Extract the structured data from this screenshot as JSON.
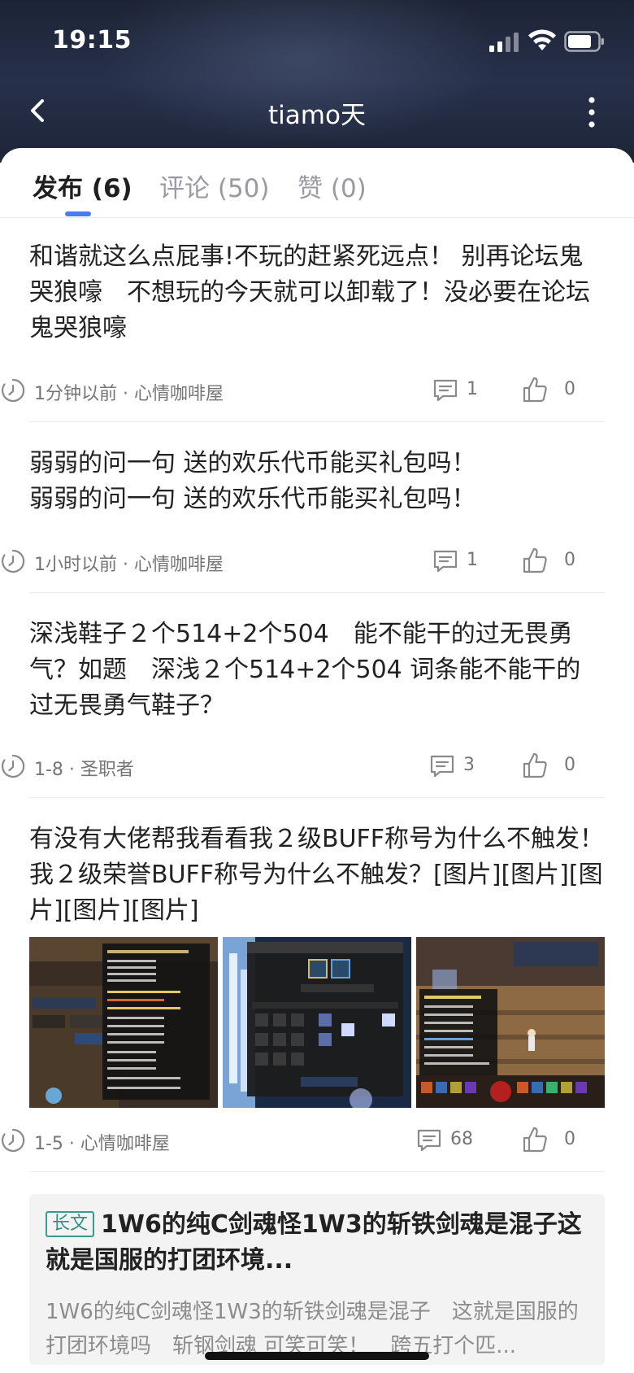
{
  "status_bar": {
    "time": "19:15"
  },
  "header": {
    "title": "tiamo天"
  },
  "tabs": [
    {
      "label": "发布 (6)",
      "active": true
    },
    {
      "label": "评论 (50)",
      "active": false
    },
    {
      "label": "赞 (0)",
      "active": false
    }
  ],
  "posts": [
    {
      "text": "和谐就这么点屁事!不玩的赶紧死远点！ 别再论坛鬼哭狼嚎　不想玩的今天就可以卸载了！没必要在论坛鬼哭狼嚎",
      "meta": "1分钟以前 · 心情咖啡屋",
      "comments": "1",
      "likes": "0"
    },
    {
      "text_line1": "弱弱的问一句 送的欢乐代币能买礼包吗！",
      "text_line2": "弱弱的问一句 送的欢乐代币能买礼包吗！",
      "meta": "1小时以前 · 心情咖啡屋",
      "comments": "1",
      "likes": "0"
    },
    {
      "text": "深浅鞋子２个514+2个504　能不能干的过无畏勇气？如题　深浅２个514+2个504 词条能不能干的过无畏勇气鞋子？",
      "meta": "1-8 · 圣职者",
      "comments": "3",
      "likes": "0"
    },
    {
      "text": "有没有大佬帮我看看我２级BUFF称号为什么不触发！ 我２级荣誉BUFF称号为什么不触发？[图片][图片][图片][图片][图片]",
      "images": [
        "game-screenshot-stats",
        "game-screenshot-equipment",
        "game-screenshot-character"
      ],
      "meta": "1-5 · 心情咖啡屋",
      "comments": "68",
      "likes": "0"
    }
  ],
  "long_post": {
    "tag": "长文",
    "title": "1W6的纯C剑魂怪1W3的斩铁剑魂是混子这就是国服的打团环境...",
    "excerpt": "1W6的纯C剑魂怪1W3的斩铁剑魂是混子　这就是国服的打团环境吗　斩钢剑魂 可笑可笑！　跨五打个匹..."
  },
  "icons": {
    "back": "chevron-left-icon",
    "more": "more-vertical-icon",
    "time": "clock-icon",
    "comment": "comment-icon",
    "like": "thumbs-up-icon"
  },
  "colors": {
    "accent": "#4a7cf1",
    "tag": "#3a9a8e",
    "header": "#1f2740"
  }
}
